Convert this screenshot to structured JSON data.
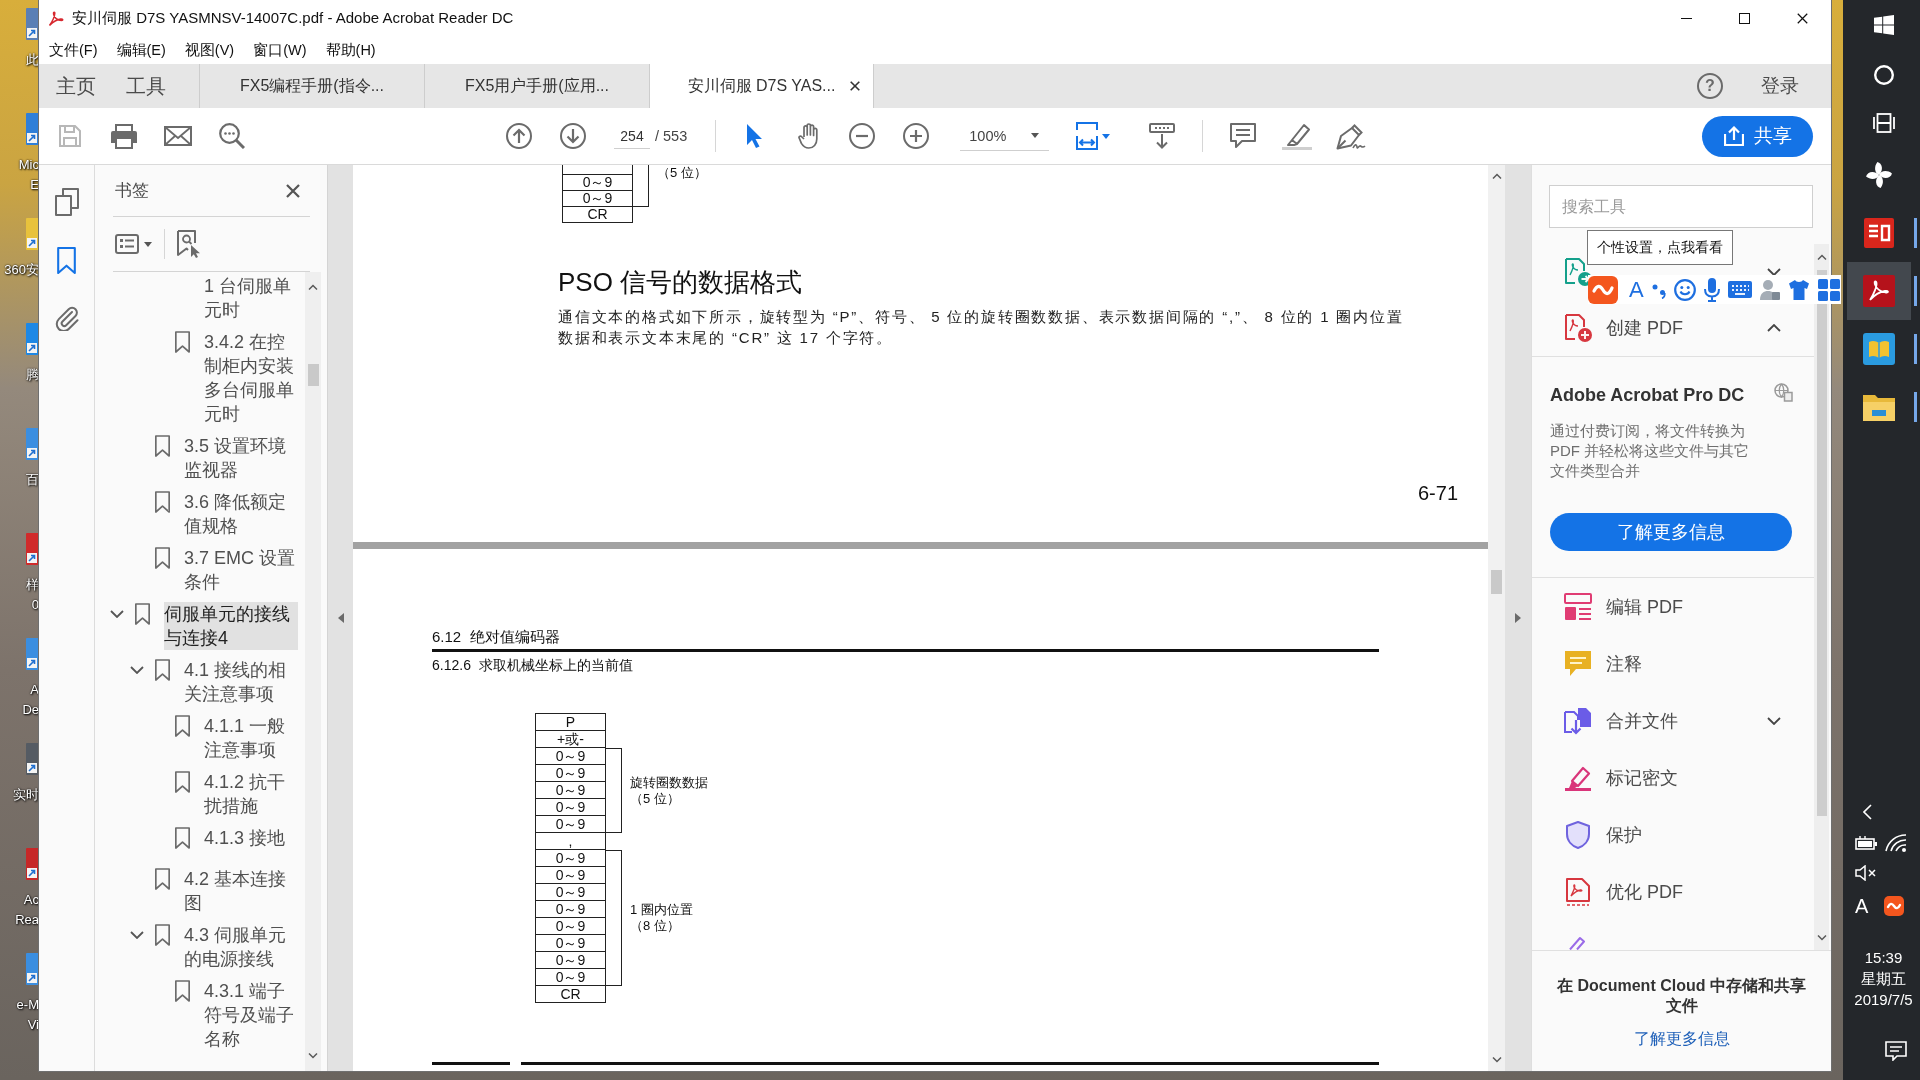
{
  "desktop": {
    "icons": [
      {
        "lines": [
          "此"
        ]
      },
      {
        "lines": [
          "Mic",
          "E"
        ]
      },
      {
        "lines": [
          "360安"
        ]
      },
      {
        "lines": [
          "腾"
        ]
      },
      {
        "lines": [
          "百"
        ]
      },
      {
        "lines": [
          "样",
          "0"
        ]
      },
      {
        "lines": [
          "A",
          "De"
        ]
      },
      {
        "lines": [
          "实时"
        ]
      },
      {
        "lines": [
          "Ac",
          "Rea"
        ]
      },
      {
        "lines": [
          "e-M",
          "Vi"
        ]
      }
    ]
  },
  "window": {
    "title": "安川伺服 D7S YASMNSV-14007C.pdf - Adobe Acrobat Reader DC",
    "menu": [
      "文件(F)",
      "编辑(E)",
      "视图(V)",
      "窗口(W)",
      "帮助(H)"
    ]
  },
  "tabs": [
    {
      "label": "主页",
      "kind": "nav",
      "selected": false
    },
    {
      "label": "工具",
      "kind": "nav",
      "selected": false
    },
    {
      "label": "FX5编程手册(指令...",
      "kind": "document",
      "selected": false
    },
    {
      "label": "FX5用户手册(应用...",
      "kind": "document",
      "selected": false
    },
    {
      "label": "安川伺服 D7S YAS...",
      "kind": "document",
      "selected": true
    }
  ],
  "account": {
    "help": "?",
    "sign_in": "登录"
  },
  "toolbar": {
    "page": "254",
    "page_count": "/ 553",
    "tools": [
      {
        "kind": "select",
        "selected": true
      },
      {
        "kind": "hand",
        "selected": false
      }
    ],
    "zoom": "100%",
    "share": "共享"
  },
  "side_rail": [
    {
      "kind": "pages",
      "selected": false
    },
    {
      "kind": "bookmarks",
      "selected": true
    },
    {
      "kind": "attachments",
      "selected": false
    }
  ],
  "bookmarks": {
    "title": "书签",
    "items": [
      {
        "children": [
          {
            "children": [
              {
                "label": "1 台伺服单元时",
                "kind": "continued",
                "selected": false
              },
              {
                "label": "3.4.2 在控制柜内安装多台伺服单元时",
                "kind": "bookmark",
                "selected": false
              }
            ]
          },
          {
            "label": "3.5 设置环境监视器",
            "kind": "bookmark",
            "selected": false
          },
          {
            "label": "3.6 降低额定值规格",
            "kind": "bookmark",
            "selected": false
          },
          {
            "label": "3.7 EMC 设置条件",
            "kind": "bookmark",
            "selected": false
          }
        ]
      },
      {
        "label": "伺服单元的接线与连接4",
        "kind": "bookmark",
        "selected": true,
        "expanded": true,
        "children": [
          {
            "label": "4.1 接线的相关注意事项",
            "kind": "bookmark",
            "selected": false,
            "expanded": true,
            "children": [
              {
                "label": "4.1.1 一般注意事项",
                "kind": "bookmark",
                "selected": false
              },
              {
                "label": "4.1.2 抗干扰措施",
                "kind": "bookmark",
                "selected": false
              },
              {
                "label": "4.1.3 接地",
                "kind": "bookmark",
                "selected": false
              }
            ]
          },
          {
            "label": "4.2 基本连接图",
            "kind": "bookmark",
            "selected": false
          },
          {
            "label": "4.3 伺服单元的电源接线",
            "kind": "bookmark",
            "selected": false,
            "expanded": true,
            "children": [
              {
                "label": "4.3.1 端子符号及端子名称",
                "kind": "bookmark",
                "selected": false
              }
            ]
          }
        ]
      }
    ]
  },
  "document": {
    "upper_page": {
      "fields": [
        {
          "cells": [
            "0～9",
            "0～9"
          ],
          "note": "（5 位）",
          "cut_top": true
        },
        {
          "cells": [
            "CR"
          ]
        }
      ],
      "heading": "PSO 信号的数据格式",
      "paragraph": "通信文本的格式如下所示，旋转型为 “P”、符号、 5 位的旋转圈数数据、表示数据间隔的 “,”、 8 位的 1 圈内位置数据和表示文本末尾的 “CR” 这 17 个字符。",
      "page_number": "6-71"
    },
    "lower_page": {
      "section": "6.12  绝对值编码器",
      "subsection": "6.12.6  求取机械坐标上的当前值",
      "fields": [
        {
          "cells": [
            "P"
          ]
        },
        {
          "cells": [
            "+或-"
          ]
        },
        {
          "cells": [
            "0～9",
            "0～9",
            "0～9",
            "0～9",
            "0～9"
          ],
          "label": "旋转圈数数据",
          "note": "（5 位）"
        },
        {
          "cells": [
            ","
          ]
        },
        {
          "cells": [
            "0～9",
            "0～9",
            "0～9",
            "0～9",
            "0～9",
            "0～9",
            "0～9",
            "0～9"
          ],
          "label": "1 圈内位置",
          "note": "（8 位）"
        },
        {
          "cells": [
            "CR"
          ]
        }
      ]
    }
  },
  "tools_pane": {
    "search": {
      "placeholder": "搜索工具"
    },
    "top_tools": [
      {
        "kind": "export",
        "expanded": false
      },
      {
        "label": "创建 PDF",
        "kind": "create",
        "expanded": true
      }
    ],
    "promo": {
      "title": "Adobe Acrobat Pro DC",
      "text": "通过付费订阅，将文件转换为 PDF 并轻松将这些文件与其它文件类型合并",
      "button": "了解更多信息"
    },
    "tools": [
      {
        "label": "编辑 PDF",
        "kind": "edit"
      },
      {
        "label": "注释",
        "kind": "comment"
      },
      {
        "label": "合并文件",
        "kind": "combine",
        "expanded": false
      },
      {
        "label": "标记密文",
        "kind": "redact"
      },
      {
        "label": "保护",
        "kind": "protect"
      },
      {
        "label": "优化 PDF",
        "kind": "optimize"
      }
    ],
    "cloud": {
      "text": "在 Document Cloud 中存储和共享文件",
      "link": "了解更多信息"
    }
  },
  "ime": {
    "tooltip": "个性设置，点我看看",
    "mode": "A"
  },
  "taskbar": {
    "apps": [
      {
        "kind": "pinwheel",
        "selected": false,
        "running": false
      },
      {
        "kind": "tile",
        "selected": false,
        "running": true
      },
      {
        "kind": "swirl",
        "selected": true,
        "running": true
      },
      {
        "kind": "book",
        "selected": false,
        "running": true
      },
      {
        "kind": "folder",
        "selected": false,
        "running": true
      }
    ],
    "input_mode": "A",
    "time": "15:39",
    "weekday": "星期五",
    "date": "2019/7/5"
  }
}
